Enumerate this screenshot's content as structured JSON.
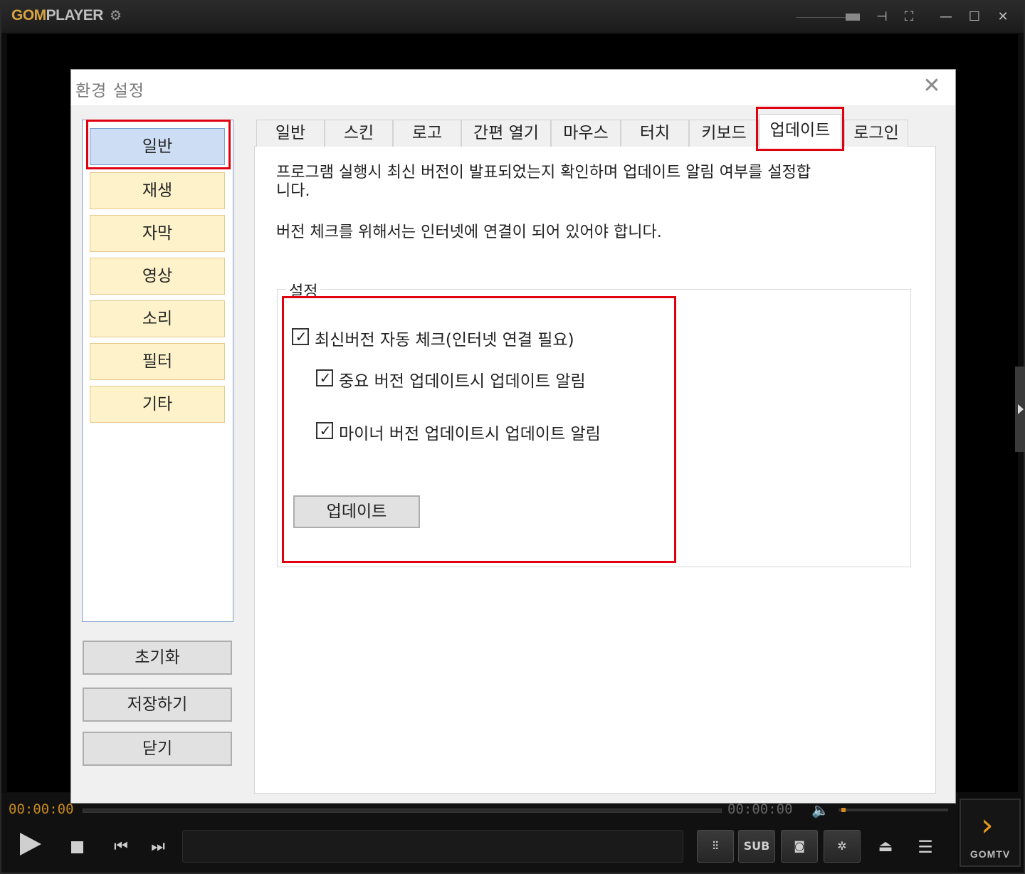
{
  "player": {
    "logo_main": "GOM",
    "logo_sub": "PLAYER",
    "time_current": "00:00:00",
    "time_total": "00:00:00",
    "sub_label": "SUB",
    "gomtv_label": "GOMTV",
    "accent_color": "#d9a441"
  },
  "dialog": {
    "title": "환경 설정",
    "sidebar": {
      "items": [
        {
          "label": "일반",
          "active": true
        },
        {
          "label": "재생"
        },
        {
          "label": "자막"
        },
        {
          "label": "영상"
        },
        {
          "label": "소리"
        },
        {
          "label": "필터"
        },
        {
          "label": "기타"
        }
      ],
      "buttons": {
        "reset": "초기화",
        "save": "저장하기",
        "close": "닫기"
      }
    },
    "tabs": [
      {
        "label": "일반"
      },
      {
        "label": "스킨"
      },
      {
        "label": "로고"
      },
      {
        "label": "간편 열기"
      },
      {
        "label": "마우스"
      },
      {
        "label": "터치"
      },
      {
        "label": "키보드"
      },
      {
        "label": "업데이트",
        "active": true
      },
      {
        "label": "로그인"
      }
    ],
    "update_page": {
      "description_line1": "프로그램 실행시 최신 버전이 발표되었는지 확인하며 업데이트 알림 여부를 설정합",
      "description_line2": "니다.",
      "internet_note": "버전 체크를 위해서는 인터넷에 연결이 되어 있어야 합니다.",
      "group_label": "설정",
      "options": [
        {
          "label": "최신버전 자동 체크(인터넷 연결 필요)",
          "checked": true
        },
        {
          "label": "중요 버전 업데이트시 업데이트 알림",
          "checked": true
        },
        {
          "label": "마이너 버전 업데이트시 업데이트 알림",
          "checked": true
        }
      ],
      "update_button": "업데이트"
    },
    "highlight_color": "#e00010"
  }
}
